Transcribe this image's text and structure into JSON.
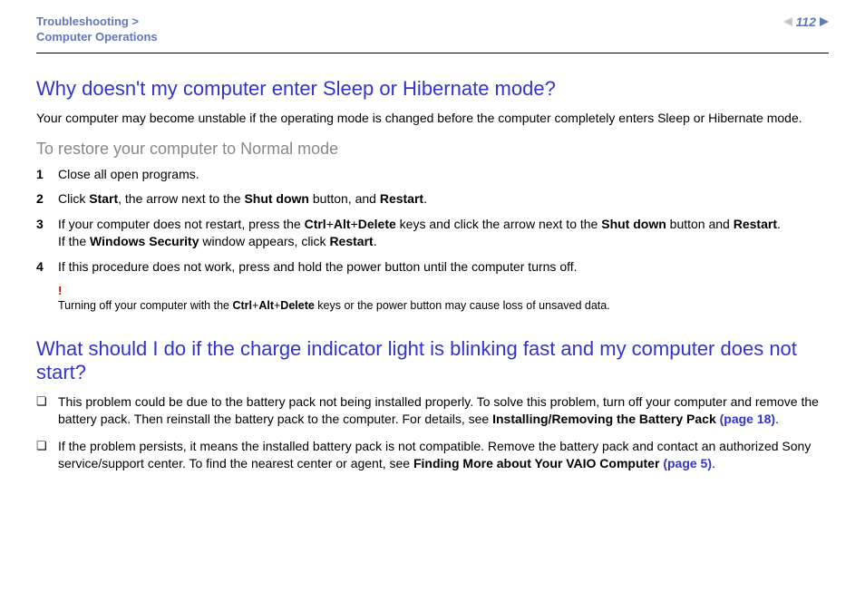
{
  "header": {
    "breadcrumb1": "Troubleshooting >",
    "breadcrumb2": "Computer Operations",
    "pagenum": "112"
  },
  "s1": {
    "title": "Why doesn't my computer enter Sleep or Hibernate mode?",
    "intro": "Your computer may become unstable if the operating mode is changed before the computer completely enters Sleep or Hibernate mode.",
    "subhead": "To restore your computer to Normal mode",
    "steps": {
      "n1": "1",
      "t1": "Close all open programs.",
      "n2": "2",
      "t2a": "Click ",
      "t2b": "Start",
      "t2c": ", the arrow next to the ",
      "t2d": "Shut down",
      "t2e": " button, and ",
      "t2f": "Restart",
      "t2g": ".",
      "n3": "3",
      "t3a": "If your computer does not restart, press the ",
      "t3b": "Ctrl",
      "t3c": "+",
      "t3d": "Alt",
      "t3e": "+",
      "t3f": "Delete",
      "t3g": " keys and click the arrow next to the ",
      "t3h": "Shut down",
      "t3i": " button and ",
      "t3j": "Restart",
      "t3k": ".",
      "t3l": "If the ",
      "t3m": "Windows Security",
      "t3n": " window appears, click ",
      "t3o": "Restart",
      "t3p": ".",
      "n4": "4",
      "t4": "If this procedure does not work, press and hold the power button until the computer turns off."
    },
    "warn_mark": "!",
    "warn_a": "Turning off your computer with the ",
    "warn_b": "Ctrl",
    "warn_c": "+",
    "warn_d": "Alt",
    "warn_e": "+",
    "warn_f": "Delete",
    "warn_g": " keys or the power button may cause loss of unsaved data."
  },
  "s2": {
    "title": "What should I do if the charge indicator light is blinking fast and my computer does not start?",
    "b1a": "This problem could be due to the battery pack not being installed properly. To solve this problem, turn off your computer and remove the battery pack. Then reinstall the battery pack to the computer. For details, see ",
    "b1b": "Installing/Removing the Battery Pack ",
    "b1c": "(page 18)",
    "b1d": ".",
    "b2a": "If the problem persists, it means the installed battery pack is not compatible. Remove the battery pack and contact an authorized Sony service/support center. To find the nearest center or agent, see ",
    "b2b": "Finding More about Your VAIO Computer ",
    "b2c": "(page 5)",
    "b2d": "."
  }
}
